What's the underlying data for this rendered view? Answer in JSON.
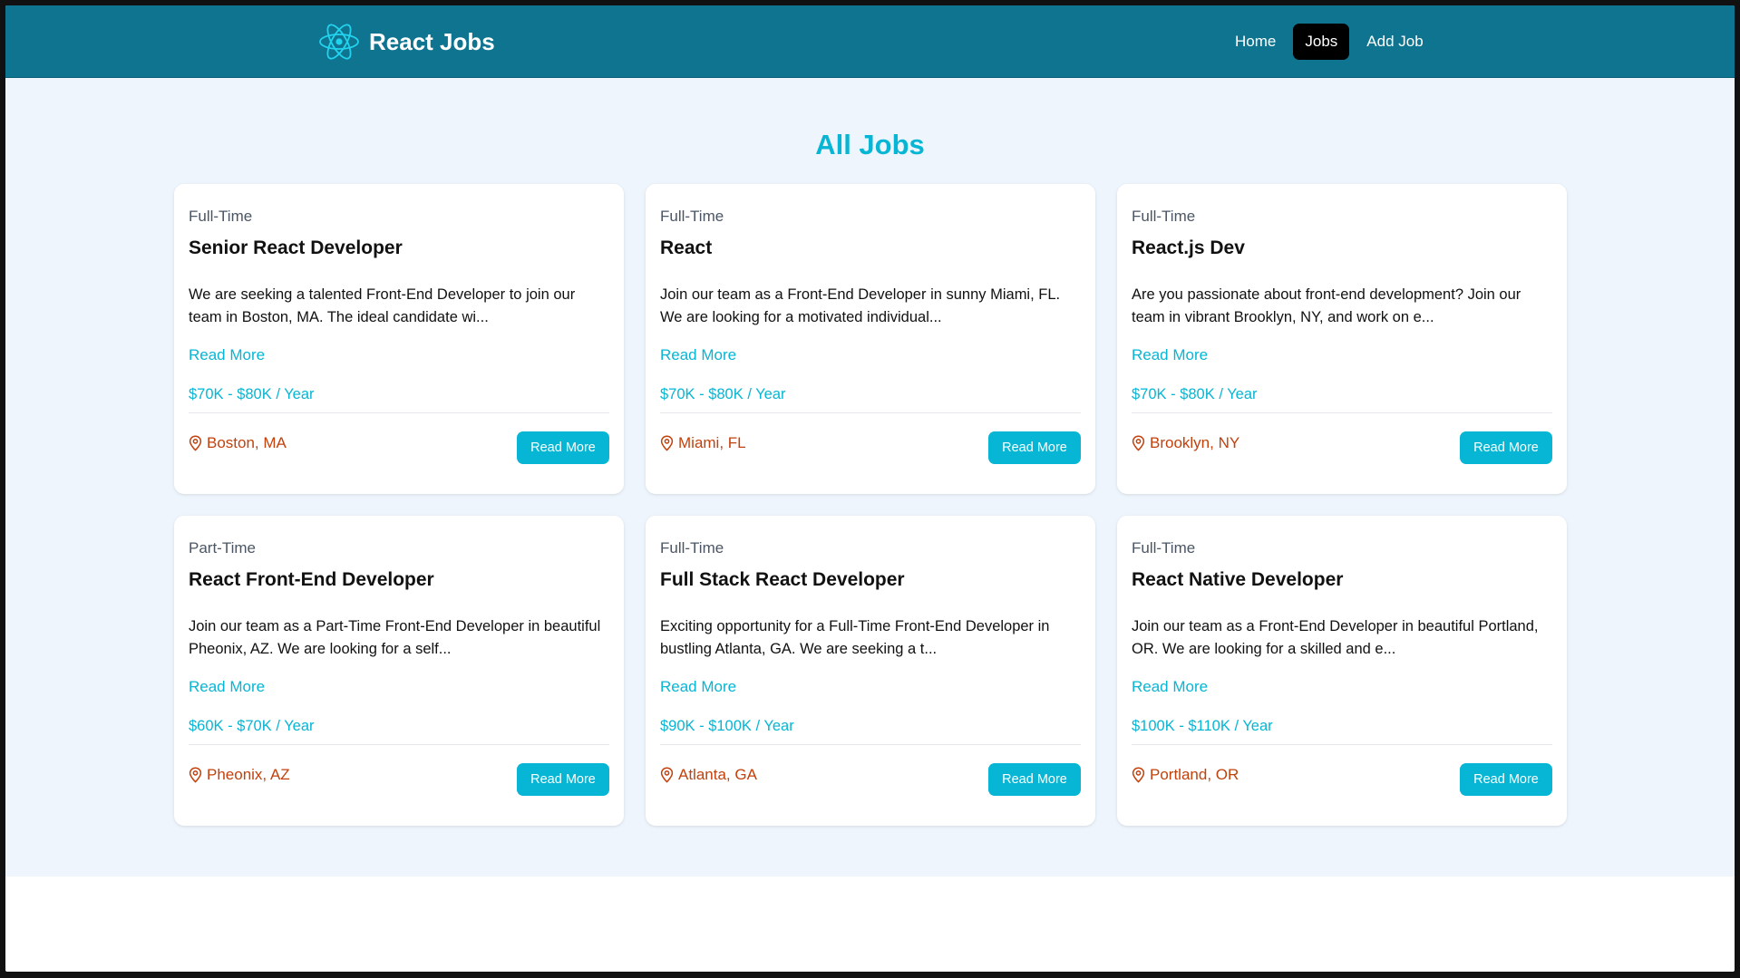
{
  "navbar": {
    "brand": "React Jobs",
    "links": [
      {
        "label": "Home",
        "active": false
      },
      {
        "label": "Jobs",
        "active": true
      },
      {
        "label": "Add Job",
        "active": false
      }
    ]
  },
  "section": {
    "title": "All Jobs"
  },
  "jobs": [
    {
      "type": "Full-Time",
      "title": "Senior React Developer",
      "description": "We are seeking a talented Front-End Developer to join our team in Boston, MA. The ideal candidate wi...",
      "link_label": "Read More",
      "salary": "$70K - $80K / Year",
      "location": "Boston, MA",
      "button_label": "Read More"
    },
    {
      "type": "Full-Time",
      "title": "React",
      "description": "Join our team as a Front-End Developer in sunny Miami, FL. We are looking for a motivated individual...",
      "link_label": "Read More",
      "salary": "$70K - $80K / Year",
      "location": "Miami, FL",
      "button_label": "Read More"
    },
    {
      "type": "Full-Time",
      "title": "React.js Dev",
      "description": "Are you passionate about front-end development? Join our team in vibrant Brooklyn, NY, and work on e...",
      "link_label": "Read More",
      "salary": "$70K - $80K / Year",
      "location": "Brooklyn, NY",
      "button_label": "Read More"
    },
    {
      "type": "Part-Time",
      "title": "React Front-End Developer",
      "description": "Join our team as a Part-Time Front-End Developer in beautiful Pheonix, AZ. We are looking for a self...",
      "link_label": "Read More",
      "salary": "$60K - $70K / Year",
      "location": "Pheonix, AZ",
      "button_label": "Read More"
    },
    {
      "type": "Full-Time",
      "title": "Full Stack React Developer",
      "description": "Exciting opportunity for a Full-Time Front-End Developer in bustling Atlanta, GA. We are seeking a t...",
      "link_label": "Read More",
      "salary": "$90K - $100K / Year",
      "location": "Atlanta, GA",
      "button_label": "Read More"
    },
    {
      "type": "Full-Time",
      "title": "React Native Developer",
      "description": "Join our team as a Front-End Developer in beautiful Portland, OR. We are looking for a skilled and e...",
      "link_label": "Read More",
      "salary": "$100K - $110K / Year",
      "location": "Portland, OR",
      "button_label": "Read More"
    }
  ],
  "icons": {
    "logo": "react-logo-icon",
    "location": "map-pin-icon"
  },
  "colors": {
    "navbar_bg": "#0e7490",
    "accent": "#06b6d4",
    "location_text": "#c2410c",
    "page_bg": "#eef5fd",
    "active_nav_bg": "#000000"
  }
}
